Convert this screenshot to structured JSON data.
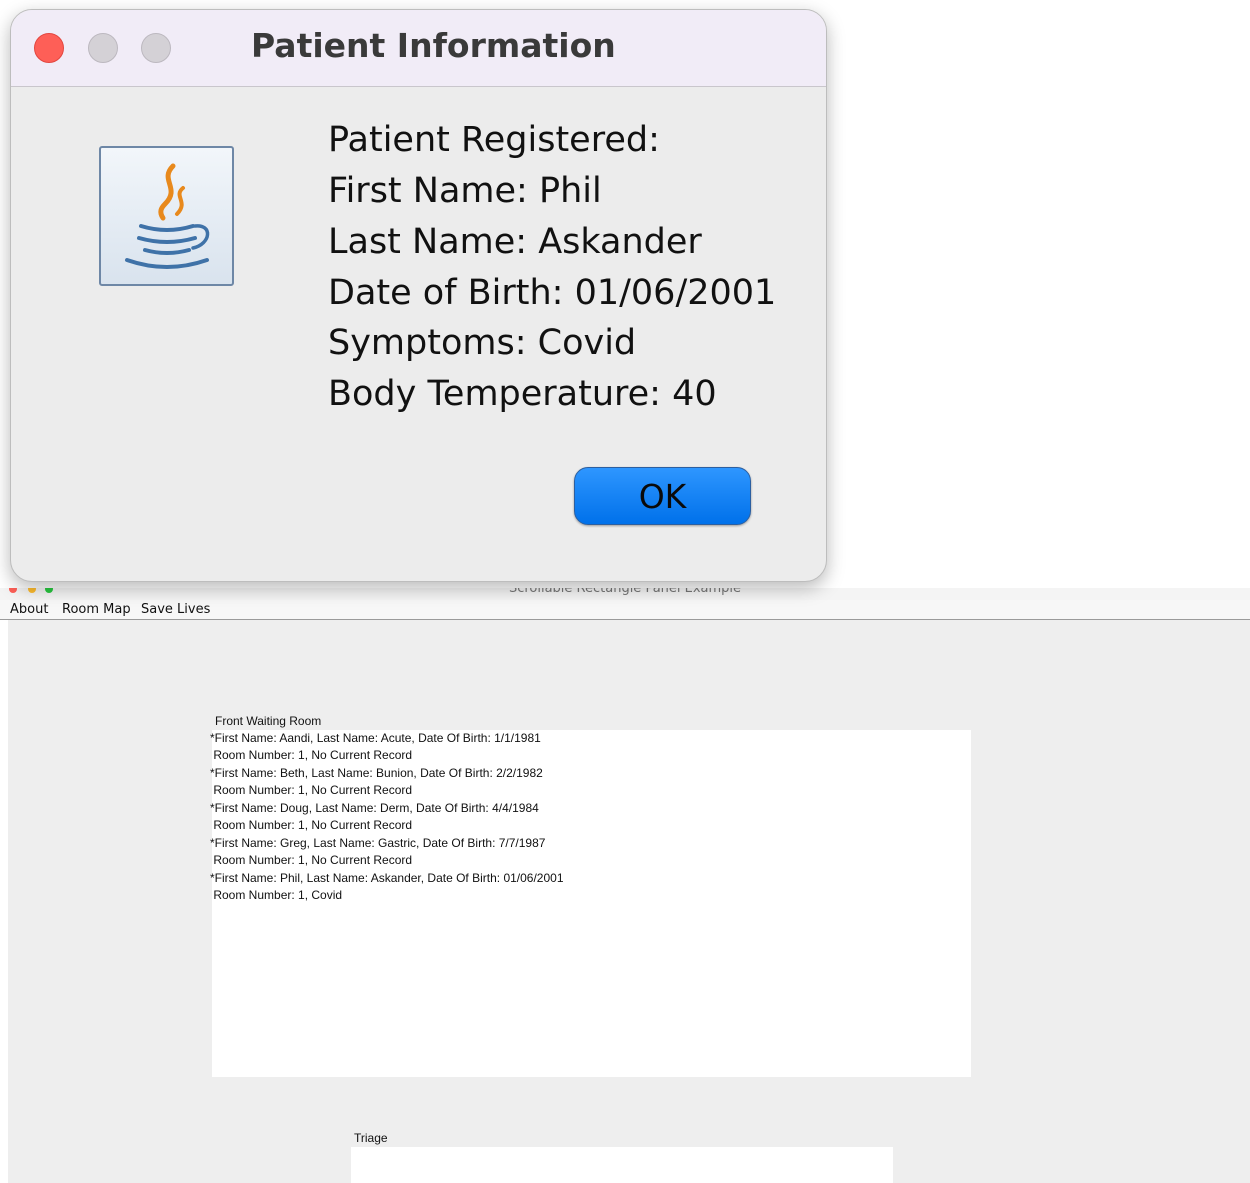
{
  "dialog": {
    "title": "Patient Information",
    "icon": "java-coffee-cup-icon",
    "message_lines": [
      "Patient Registered:",
      "First Name: Phil",
      "Last Name: Askander",
      "Date of Birth: 01/06/2001",
      "Symptoms: Covid",
      "Body Temperature: 40"
    ],
    "ok_label": "OK",
    "colors": {
      "close": "#fe5f57",
      "button": "#0a7cf5"
    }
  },
  "main_window": {
    "title": "Scrollable Rectangle Panel Example",
    "menu": [
      "About",
      "Room Map",
      "Save Lives"
    ],
    "front_waiting_room": {
      "label": "Front Waiting Room",
      "lines": [
        "*First Name: Aandi, Last Name: Acute, Date Of Birth: 1/1/1981",
        " Room Number: 1, No Current Record",
        "*First Name: Beth, Last Name: Bunion, Date Of Birth: 2/2/1982",
        " Room Number: 1, No Current Record",
        "*First Name: Doug, Last Name: Derm, Date Of Birth: 4/4/1984",
        " Room Number: 1, No Current Record",
        "*First Name: Greg, Last Name: Gastric, Date Of Birth: 7/7/1987",
        " Room Number: 1, No Current Record",
        "*First Name: Phil, Last Name: Askander, Date Of Birth: 01/06/2001",
        " Room Number: 1, Covid"
      ]
    },
    "triage": {
      "label": "Triage"
    }
  }
}
